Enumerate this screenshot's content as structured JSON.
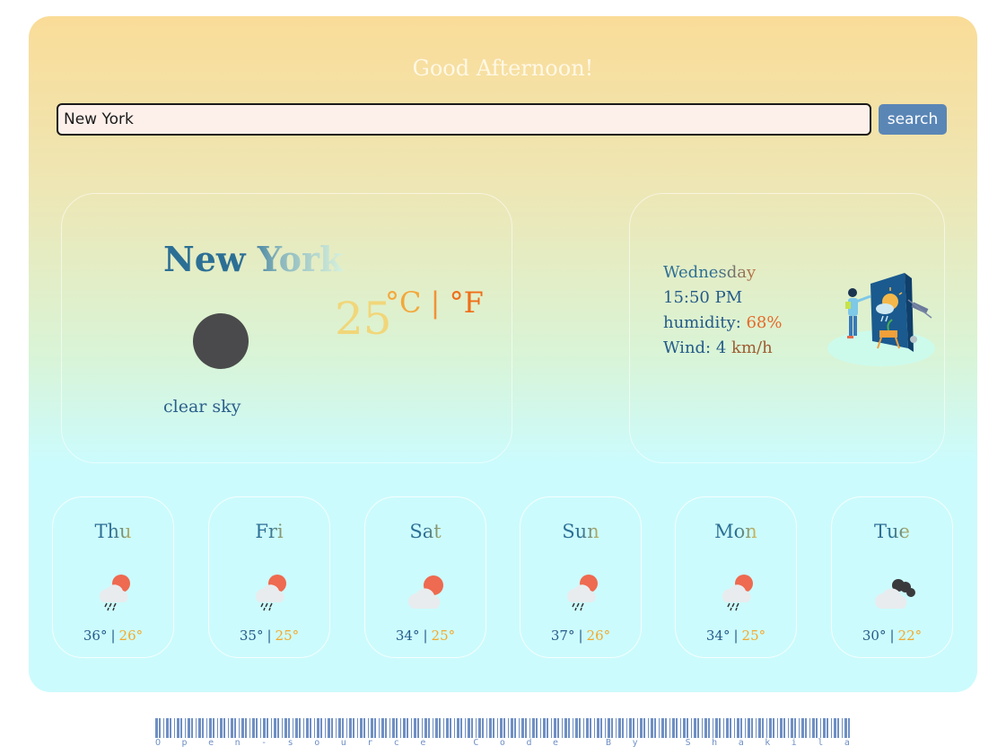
{
  "greeting": "Good Afternoon!",
  "search": {
    "value": "New York",
    "button_label": "search"
  },
  "current": {
    "city": "New York",
    "temperature": "25",
    "unit_c": "°C",
    "unit_separator": "|",
    "unit_f": "°F",
    "description": "clear sky",
    "icon": "dark-circle-icon"
  },
  "details": {
    "day": "Wednesday",
    "time": "15:50 PM",
    "humidity_label": "humidity: ",
    "humidity_value": "68%",
    "wind_label": "Wind: 4 ",
    "wind_unit": "km/h",
    "illustration": "weather-forecaster-illustration"
  },
  "forecast": [
    {
      "day": "Thu",
      "max": "36°",
      "min": "26°",
      "icon": "rain-sun-icon"
    },
    {
      "day": "Fri",
      "max": "35°",
      "min": "25°",
      "icon": "rain-sun-icon"
    },
    {
      "day": "Sat",
      "max": "34°",
      "min": "25°",
      "icon": "cloud-sun-icon"
    },
    {
      "day": "Sun",
      "max": "37°",
      "min": "26°",
      "icon": "rain-sun-icon"
    },
    {
      "day": "Mon",
      "max": "34°",
      "min": "25°",
      "icon": "rain-sun-icon"
    },
    {
      "day": "Tue",
      "max": "30°",
      "min": "22°",
      "icon": "dark-cloud-icon"
    }
  ],
  "footer": {
    "text": "Open-source Code By Shakila"
  },
  "colors": {
    "accent_blue": "#5a86b6",
    "text_blue": "#245b8a",
    "orange": "#ef6e19",
    "yellow": "#f4a92b"
  }
}
